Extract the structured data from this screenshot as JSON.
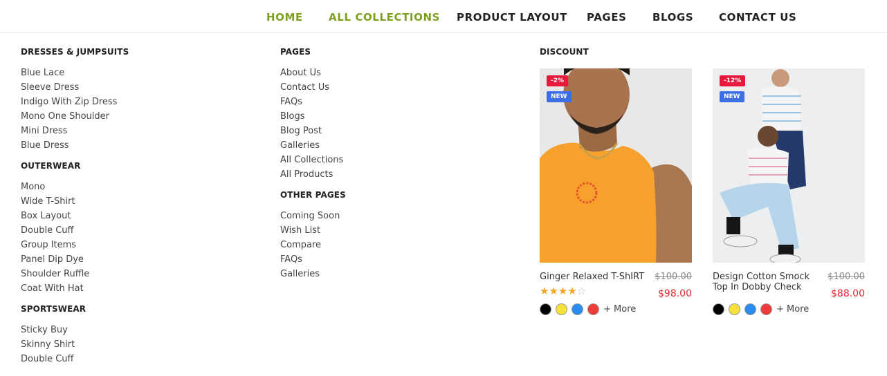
{
  "nav": {
    "items": [
      "HOME",
      "ALL COLLECTIONS",
      "PRODUCT LAYOUT",
      "PAGES",
      "BLOGS",
      "CONTACT US"
    ],
    "active_color": "#7ca01e"
  },
  "col1": {
    "groups": [
      {
        "title": "DRESSES & JUMPSUITS",
        "items": [
          "Blue Lace",
          "Sleeve Dress",
          "Indigo With Zip Dress",
          "Mono One Shoulder",
          "Mini Dress",
          "Blue Dress"
        ]
      },
      {
        "title": "OUTERWEAR",
        "items": [
          "Mono",
          "Wide T-Shirt",
          "Box Layout",
          "Double Cuff",
          "Group Items",
          "Panel Dip Dye",
          "Shoulder Ruffle",
          "Coat With Hat"
        ]
      },
      {
        "title": "SPORTSWEAR",
        "items": [
          "Sticky Buy",
          "Skinny Shirt",
          "Double Cuff"
        ]
      }
    ]
  },
  "col2": {
    "groups": [
      {
        "title": "PAGES",
        "items": [
          "About Us",
          "Contact Us",
          "FAQs",
          "Blogs",
          "Blog Post",
          "Galleries",
          "All Collections",
          "All Products"
        ]
      },
      {
        "title": "OTHER PAGES",
        "items": [
          "Coming Soon",
          "Wish List",
          "Compare",
          "FAQs",
          "Galleries"
        ]
      }
    ]
  },
  "discount": {
    "title": "DISCOUNT",
    "products": [
      {
        "badge_sale": "-2%",
        "badge_new": "NEW",
        "name": "Ginger Relaxed T-ShIRT",
        "price_old": "$100.00",
        "price_new": "$98.00",
        "rating": 4,
        "rating_max": 5,
        "more": "+ More"
      },
      {
        "badge_sale": "-12%",
        "badge_new": "NEW",
        "name": "Design Cotton Smock Top In Dobby Check",
        "price_old": "$100.00",
        "price_new": "$88.00",
        "more": "+ More"
      }
    ],
    "swatch_colors": [
      "#000000",
      "#f7e23a",
      "#2b8cf0",
      "#ee3b3b"
    ]
  }
}
